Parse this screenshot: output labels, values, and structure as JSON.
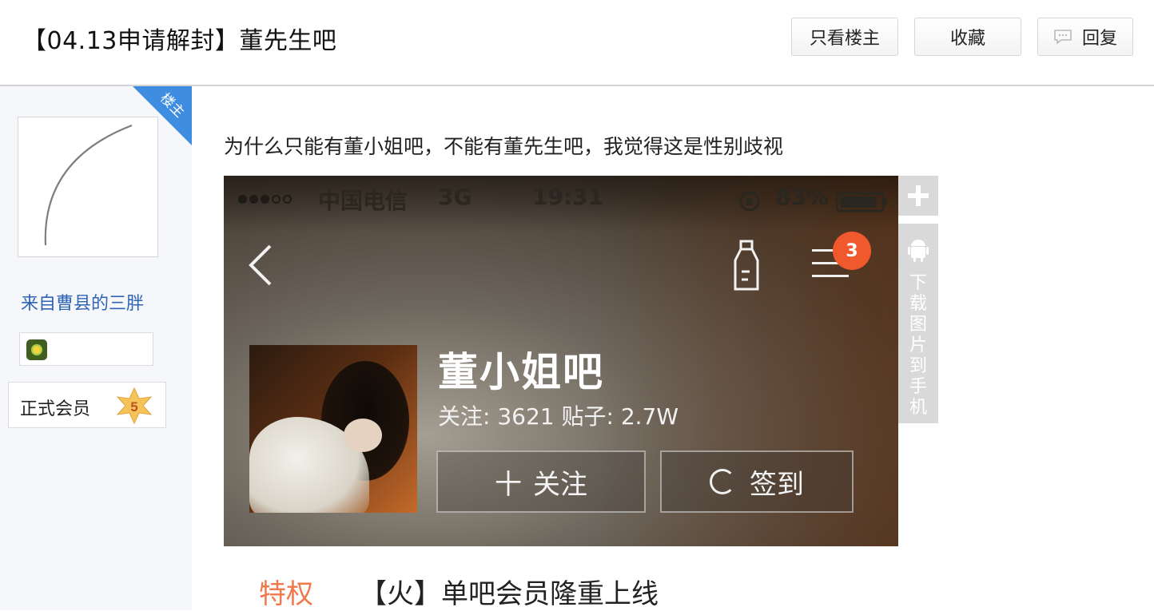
{
  "header": {
    "title": "【04.13申请解封】董先生吧",
    "only_owner_label": "只看楼主",
    "favorite_label": "收藏",
    "reply_label": "回复"
  },
  "sidebar": {
    "owner_tag": "楼主",
    "username": "来自曹县的三胖",
    "member_label": "正式会员",
    "member_level": "5"
  },
  "post": {
    "text": "为什么只能有董小姐吧，不能有董先生吧，我觉得这是性别歧视"
  },
  "screenshot": {
    "carrier": "中国电信",
    "network": "3G",
    "time": "19:31",
    "battery": "83%",
    "notification_count": "3",
    "bar_name": "董小姐吧",
    "stats": "关注: 3621  贴子: 2.7W",
    "follow_label": "关注",
    "follow_prefix": "十",
    "sign_label": "签到"
  },
  "tools": {
    "download_label": "下载图片到手机"
  },
  "promo": {
    "privilege": "特权",
    "text": "【火】单吧会员隆重上线"
  },
  "colors": {
    "accent_blue": "#3e8de0",
    "username": "#2d64b3",
    "badge_red": "#f0592b",
    "privilege_orange": "#f0784a"
  }
}
